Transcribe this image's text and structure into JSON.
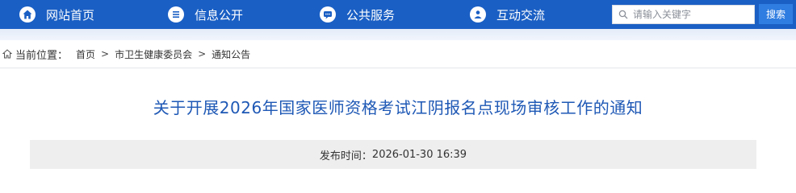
{
  "nav": {
    "items": [
      {
        "label": "网站首页",
        "icon": "home-icon"
      },
      {
        "label": "信息公开",
        "icon": "list-icon"
      },
      {
        "label": "公共服务",
        "icon": "chat-icon"
      },
      {
        "label": "互动交流",
        "icon": "people-icon"
      }
    ],
    "search_placeholder": "请输入关键字",
    "search_button": "搜索",
    "color": "#1a5fc4"
  },
  "breadcrumb": {
    "prefix": "当前位置：",
    "items": [
      "首页",
      "市卫生健康委员会",
      "通知公告"
    ],
    "separator": ">"
  },
  "article": {
    "title": "关于开展2026年国家医师资格考试江阴报名点现场审核工作的通知",
    "publish_label": "发布时间：",
    "publish_time": "2026-01-30 16:39",
    "title_color": "#1e58b5"
  }
}
